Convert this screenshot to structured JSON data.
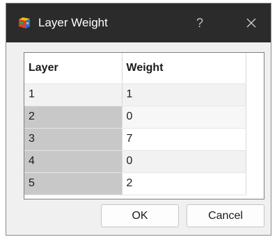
{
  "window": {
    "title": "Layer Weight",
    "help_label": "?"
  },
  "table": {
    "headers": [
      "Layer",
      "Weight"
    ],
    "rows": [
      {
        "layer": "1",
        "weight": "1"
      },
      {
        "layer": "2",
        "weight": "0"
      },
      {
        "layer": "3",
        "weight": "7"
      },
      {
        "layer": "4",
        "weight": "0"
      },
      {
        "layer": "5",
        "weight": "2"
      }
    ]
  },
  "buttons": {
    "ok": "OK",
    "cancel": "Cancel"
  },
  "icons": {
    "app": "cube-app-icon",
    "help": "help-icon",
    "close": "close-icon"
  }
}
